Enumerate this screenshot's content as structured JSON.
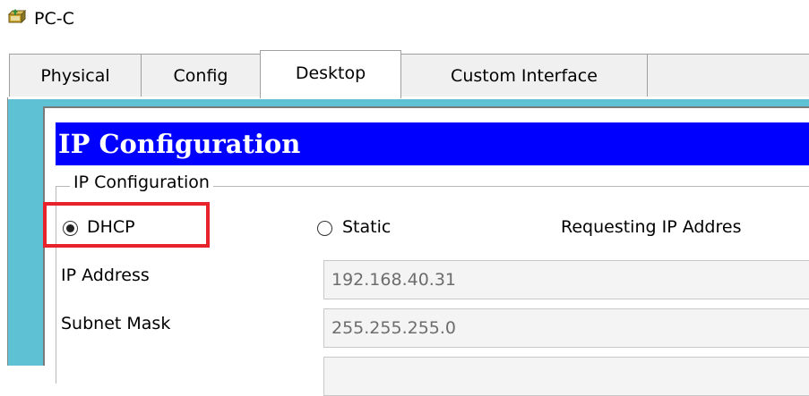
{
  "window": {
    "title": "PC-C",
    "icon": "pc-device-icon"
  },
  "tabs": [
    {
      "label": "Physical"
    },
    {
      "label": "Config"
    },
    {
      "label": "Desktop",
      "active": true
    },
    {
      "label": "Custom Interface"
    }
  ],
  "ip_config": {
    "header": "IP Configuration",
    "group_label": "IP Configuration",
    "mode_selected": "DHCP",
    "options": [
      {
        "label": "DHCP",
        "checked": true
      },
      {
        "label": "Static",
        "checked": false
      }
    ],
    "status_text": "Requesting IP Addres",
    "fields": {
      "ip_address": {
        "label": "IP Address",
        "value": "192.168.40.31"
      },
      "subnet_mask": {
        "label": "Subnet Mask",
        "value": "255.255.255.0"
      },
      "gateway": {
        "label": "",
        "value": ""
      }
    }
  },
  "colors": {
    "header_bg": "#0000ff",
    "desktop_accent": "#5fc1d4",
    "highlight": "#e8222a"
  }
}
